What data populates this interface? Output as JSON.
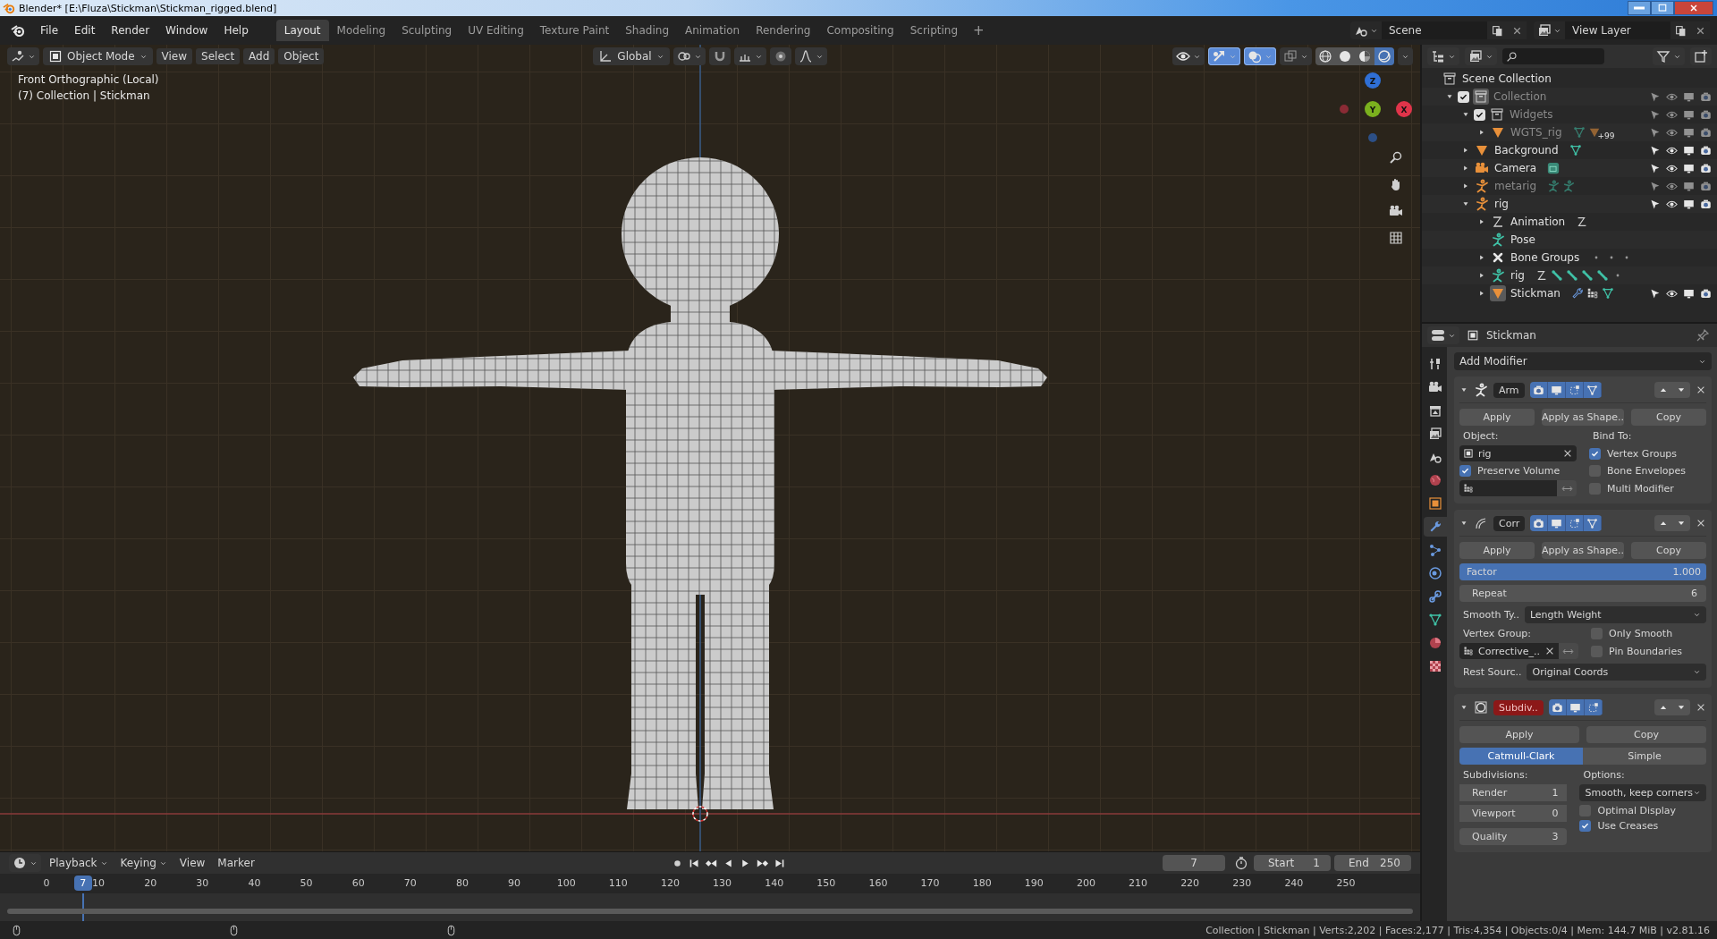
{
  "title_bar": {
    "title": "Blender* [E:\\Fluza\\Stickman\\Stickman_rigged.blend]"
  },
  "menu": [
    "File",
    "Edit",
    "Render",
    "Window",
    "Help"
  ],
  "workspaces": [
    {
      "label": "Layout",
      "selected": true
    },
    {
      "label": "Modeling",
      "selected": false
    },
    {
      "label": "Sculpting",
      "selected": false
    },
    {
      "label": "UV Editing",
      "selected": false
    },
    {
      "label": "Texture Paint",
      "selected": false
    },
    {
      "label": "Shading",
      "selected": false
    },
    {
      "label": "Animation",
      "selected": false
    },
    {
      "label": "Rendering",
      "selected": false
    },
    {
      "label": "Compositing",
      "selected": false
    },
    {
      "label": "Scripting",
      "selected": false
    }
  ],
  "add_workspace": "+",
  "scene": {
    "value": "Scene"
  },
  "view_layer": {
    "value": "View Layer"
  },
  "viewport": {
    "mode": "Object Mode",
    "menus": [
      "View",
      "Select",
      "Add",
      "Object"
    ],
    "orientation": "Global",
    "view_name": "Front Orthographic (Local)",
    "context": "(7) Collection | Stickman",
    "axes": [
      {
        "label": "Z",
        "color": "#2f6fd6"
      },
      {
        "label": "Y",
        "color": "#7bb11e"
      },
      {
        "label": "X",
        "color": "#e0344a"
      }
    ],
    "toggles": [
      {
        "kind": "visibility",
        "on": false
      },
      {
        "kind": "gizmo",
        "on": true
      },
      {
        "kind": "overlay",
        "on": true
      },
      {
        "kind": "xray",
        "on": false
      }
    ],
    "shading": [
      {
        "kind": "wireframe",
        "selected": false
      },
      {
        "kind": "solid",
        "selected": false
      },
      {
        "kind": "material",
        "selected": false
      },
      {
        "kind": "rendered",
        "selected": true
      }
    ]
  },
  "outliner": {
    "tree": [
      {
        "label": "Scene Collection",
        "kind": "scene-collection",
        "dimmed": false,
        "active": false,
        "children": [
          {
            "label": "Collection",
            "kind": "collection",
            "checked": true,
            "dimmed": true,
            "active": true,
            "expanded": true,
            "children": [
              {
                "label": "Widgets",
                "kind": "collection",
                "checked": true,
                "dimmed": true,
                "active": false,
                "expanded": true,
                "children": [
                  {
                    "label": "WGTS_rig",
                    "kind": "mesh",
                    "dimmed": true,
                    "active": false,
                    "expanded": false,
                    "extras": [
                      {
                        "kind": "mesh-data"
                      },
                      {
                        "kind": "mesh"
                      }
                    ],
                    "badge": "+99"
                  }
                ]
              },
              {
                "label": "Background",
                "kind": "mesh",
                "dimmed": false,
                "active": false,
                "expanded": false,
                "extras": [
                  {
                    "kind": "mesh-data"
                  }
                ]
              },
              {
                "label": "Camera",
                "kind": "camera",
                "dimmed": false,
                "active": false,
                "expanded": false,
                "extras": [
                  {
                    "kind": "camera-data"
                  }
                ]
              },
              {
                "label": "metarig",
                "kind": "armature",
                "dimmed": true,
                "active": false,
                "expanded": false,
                "extras": [
                  {
                    "kind": "armature-data"
                  },
                  {
                    "kind": "pose"
                  }
                ]
              },
              {
                "label": "rig",
                "kind": "armature",
                "dimmed": false,
                "active": false,
                "expanded": true,
                "children": [
                  {
                    "label": "Animation",
                    "kind": "action",
                    "dimmed": false,
                    "active": false,
                    "expanded": false,
                    "extras": [
                      {
                        "kind": "action"
                      }
                    ]
                  },
                  {
                    "label": "Pose",
                    "kind": "pose",
                    "dimmed": false,
                    "active": false
                  },
                  {
                    "label": "Bone Groups",
                    "kind": "bone-groups",
                    "dimmed": false,
                    "active": false,
                    "expanded": false,
                    "extras": [
                      {
                        "kind": "dot"
                      },
                      {
                        "kind": "dot"
                      },
                      {
                        "kind": "dot"
                      }
                    ]
                  },
                  {
                    "label": "rig",
                    "kind": "armature-data",
                    "dimmed": false,
                    "active": false,
                    "expanded": false,
                    "extras": [
                      {
                        "kind": "action"
                      },
                      {
                        "kind": "bone"
                      },
                      {
                        "kind": "bone"
                      },
                      {
                        "kind": "bone"
                      },
                      {
                        "kind": "bone"
                      },
                      {
                        "kind": "dot"
                      }
                    ]
                  },
                  {
                    "label": "Stickman",
                    "kind": "mesh",
                    "dimmed": false,
                    "active": true,
                    "expanded": false,
                    "extras": [
                      {
                        "kind": "wrench"
                      },
                      {
                        "kind": "vertex-groups"
                      },
                      {
                        "kind": "mesh-data"
                      }
                    ]
                  }
                ]
              }
            ]
          }
        ]
      }
    ]
  },
  "properties": {
    "object": "Stickman",
    "tabs": [
      {
        "kind": "tool",
        "selected": false
      },
      {
        "kind": "render",
        "selected": false
      },
      {
        "kind": "output",
        "selected": false
      },
      {
        "kind": "view-layer",
        "selected": false
      },
      {
        "kind": "scene",
        "selected": false
      },
      {
        "kind": "world",
        "selected": false
      },
      {
        "kind": "object",
        "selected": false
      },
      {
        "kind": "modifier",
        "selected": true
      },
      {
        "kind": "particles",
        "selected": false
      },
      {
        "kind": "physics",
        "selected": false
      },
      {
        "kind": "constraints",
        "selected": false
      },
      {
        "kind": "data",
        "selected": false
      },
      {
        "kind": "material",
        "selected": false
      },
      {
        "kind": "texture",
        "selected": false
      }
    ],
    "add_modifier": "Add Modifier",
    "modifiers": [
      {
        "kind": "armature",
        "name": "Arm",
        "alert": false,
        "expanded": true,
        "toggles": [
          {
            "kind": "render",
            "on": true
          },
          {
            "kind": "viewport",
            "on": true
          },
          {
            "kind": "editmode",
            "on": true
          },
          {
            "kind": "cage",
            "on": true
          }
        ],
        "buttons": [
          "Apply",
          "Apply as Shape..",
          "Copy"
        ],
        "object_label": "Object:",
        "object": "rig",
        "bind_label": "Bind To:",
        "options": [
          {
            "label": "Vertex Groups",
            "checked": true
          },
          {
            "label": "Bone Envelopes",
            "checked": false
          },
          {
            "label": "Multi Modifier",
            "checked": false
          }
        ],
        "preserve_volume": {
          "label": "Preserve Volume",
          "checked": true
        }
      },
      {
        "kind": "corrective-smooth",
        "name": "Corr",
        "alert": false,
        "expanded": true,
        "toggles": [
          {
            "kind": "render",
            "on": true
          },
          {
            "kind": "viewport",
            "on": true
          },
          {
            "kind": "editmode",
            "on": true
          },
          {
            "kind": "cage",
            "on": true
          }
        ],
        "buttons": [
          "Apply",
          "Apply as Shape..",
          "Copy"
        ],
        "factor": {
          "label": "Factor",
          "value": "1.000",
          "level": 1
        },
        "repeat": {
          "label": "Repeat",
          "value": "6"
        },
        "smooth_type": {
          "label": "Smooth Ty..",
          "value": "Length Weight"
        },
        "vertex_group_label": "Vertex Group:",
        "vertex_group": "Corrective_..",
        "options": [
          {
            "label": "Only Smooth",
            "checked": false
          },
          {
            "label": "Pin Boundaries",
            "checked": false
          }
        ],
        "rest_source": {
          "label": "Rest Sourc..",
          "value": "Original Coords"
        }
      },
      {
        "kind": "subdivision",
        "name": "Subdiv..",
        "alert": true,
        "expanded": true,
        "toggles": [
          {
            "kind": "render",
            "on": true
          },
          {
            "kind": "viewport",
            "on": true
          },
          {
            "kind": "editmode",
            "on": true
          }
        ],
        "buttons": [
          "Apply",
          "Copy"
        ],
        "algorithms": [
          {
            "label": "Catmull-Clark",
            "selected": true
          },
          {
            "label": "Simple",
            "selected": false
          }
        ],
        "subdivisions_label": "Subdivisions:",
        "levels": [
          {
            "label": "Render",
            "value": "1"
          },
          {
            "label": "Viewport",
            "value": "0"
          },
          {
            "label": "Quality",
            "value": "3"
          }
        ],
        "options_label": "Options:",
        "uv_smooth": "Smooth, keep corners",
        "options": [
          {
            "label": "Optimal Display",
            "checked": false
          },
          {
            "label": "Use Creases",
            "checked": true
          }
        ]
      }
    ]
  },
  "timeline": {
    "menus": [
      "Playback",
      "Keying",
      "View",
      "Marker"
    ],
    "current_frame": "7",
    "start_label": "Start",
    "start": "1",
    "end_label": "End",
    "end": "250",
    "ruler": [
      "0",
      "10",
      "20",
      "30",
      "40",
      "50",
      "60",
      "70",
      "80",
      "90",
      "100",
      "110",
      "120",
      "130",
      "140",
      "150",
      "160",
      "170",
      "180",
      "190",
      "200",
      "210",
      "220",
      "230",
      "240",
      "250"
    ],
    "playhead": {
      "label": "7",
      "level": 0.028
    }
  },
  "status_bar": {
    "stats": "Collection | Stickman | Verts:2,202 | Faces:2,177 | Tris:4,354 | Objects:0/4 | Mem: 144.7 MiB | v2.81.16"
  }
}
